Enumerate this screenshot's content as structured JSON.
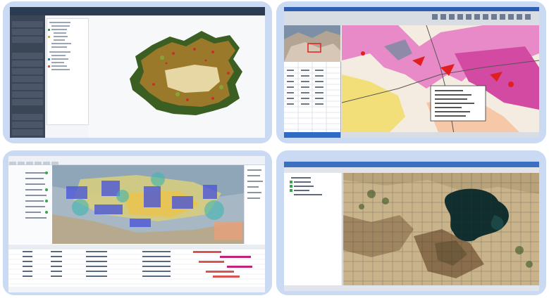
{
  "collage": {
    "panels": [
      {
        "name": "web-gis-xinjiang-map",
        "description_text": ""
      },
      {
        "name": "desktop-gis-geology-map",
        "description_text": ""
      },
      {
        "name": "web-gis-density-map",
        "description_text": ""
      },
      {
        "name": "desktop-gis-lake-image",
        "description_text": ""
      }
    ]
  },
  "colors": {
    "panel_bg": "#c9daf2",
    "map_pink": "#e98ac8",
    "map_magenta": "#d24aa2",
    "map_yellow": "#f2df7a",
    "map_green": "#4c8a2d",
    "lake_dark": "#0f2e2d",
    "land_tan": "#c9b38b"
  }
}
